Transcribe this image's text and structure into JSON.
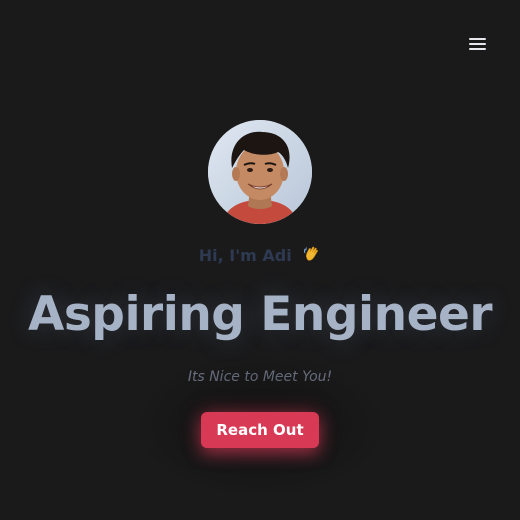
{
  "nav": {
    "menu_icon": "hamburger-menu-icon"
  },
  "hero": {
    "avatar_alt": "profile photo",
    "greeting": "Hi, I'm Adi",
    "wave_icon": "waving-hand-icon",
    "headline": "Aspiring Engineer",
    "tagline": "Its Nice to Meet You!",
    "cta_label": "Reach Out"
  },
  "colors": {
    "background": "#1a1a1b",
    "greeting": "#2d3a52",
    "headline": "#a6b2c6",
    "tagline": "#6f7586",
    "accent": "#d83a55"
  }
}
